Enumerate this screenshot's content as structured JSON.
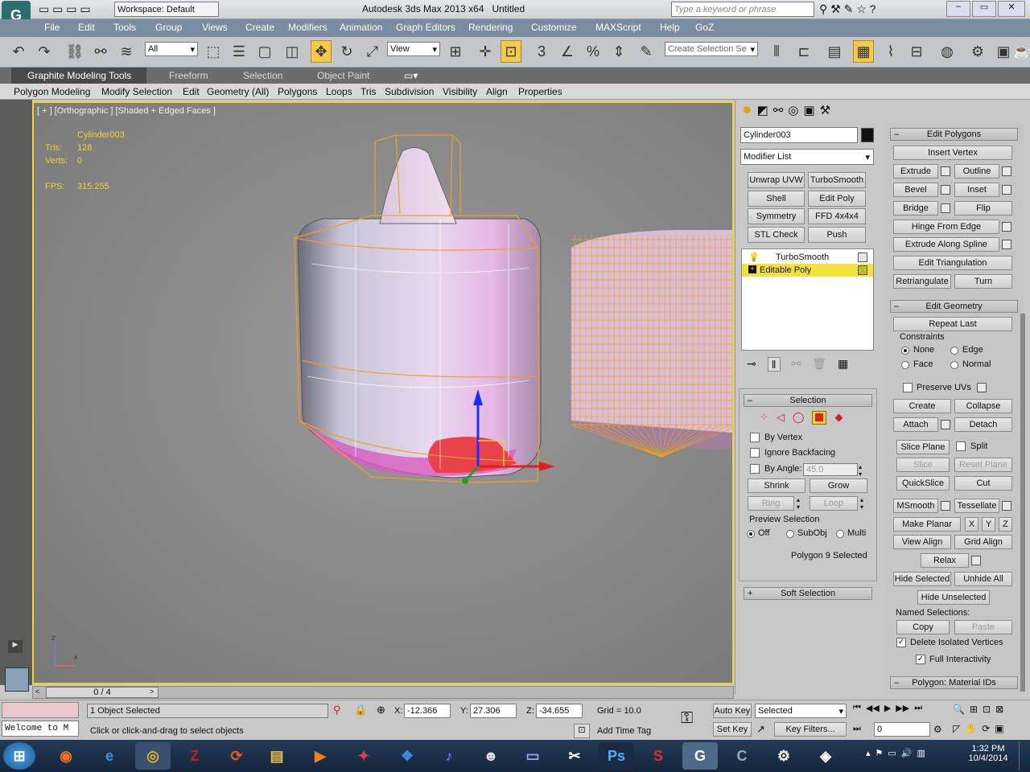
{
  "window": {
    "title": "Autodesk 3ds Max 2013 x64",
    "file": "Untitled",
    "workspace": "Workspace: Default",
    "search_placeholder": "Type a keyword or phrase"
  },
  "menu": [
    "File",
    "Edit",
    "Tools",
    "Group",
    "Views",
    "Create",
    "Modifiers",
    "Animation",
    "Graph Editors",
    "Rendering",
    "Customize",
    "MAXScript",
    "Help",
    "GoZ"
  ],
  "toolbar": {
    "filter": "All",
    "refcoord": "View",
    "selection_set": "Create Selection Se"
  },
  "ribbon_tabs": [
    "Graphite Modeling Tools",
    "Freeform",
    "Selection",
    "Object Paint"
  ],
  "ribbon_items": [
    "Polygon Modeling",
    "Modify Selection",
    "Edit",
    "Geometry (All)",
    "Polygons",
    "Loops",
    "Tris",
    "Subdivision",
    "Visibility",
    "Align",
    "Properties"
  ],
  "viewport": {
    "label": "[ + ] [Orthographic ] [Shaded + Edged Faces ]",
    "object": "Cylinder003",
    "tris_label": "Tris:",
    "tris": "128",
    "verts_label": "Verts:",
    "verts": "0",
    "fps_label": "FPS:",
    "fps": "315.255",
    "axis_z": "z",
    "axis_x": "x"
  },
  "command": {
    "name": "Cylinder003",
    "modifier_list": "Modifier List",
    "modbuttons": [
      "Unwrap UVW",
      "TurboSmooth",
      "Shell",
      "Edit Poly",
      "Symmetry",
      "FFD 4x4x4",
      "STL Check",
      "Push"
    ],
    "stack": [
      "TurboSmooth",
      "Editable Poly"
    ],
    "selection_header": "Selection",
    "by_vertex": "By Vertex",
    "ignore_backfacing": "Ignore Backfacing",
    "by_angle": "By Angle:",
    "angle_value": "45.0",
    "shrink": "Shrink",
    "grow": "Grow",
    "ring": "Ring",
    "loop": "Loop",
    "preview_selection": "Preview Selection",
    "preview_opts": [
      "Off",
      "SubObj",
      "Multi"
    ],
    "selected_info": "Polygon 9 Selected",
    "soft_selection": "Soft Selection"
  },
  "edit_polygons": {
    "header": "Edit Polygons",
    "insert_vertex": "Insert Vertex",
    "extrude": "Extrude",
    "outline": "Outline",
    "bevel": "Bevel",
    "inset": "Inset",
    "bridge": "Bridge",
    "flip": "Flip",
    "hinge": "Hinge From Edge",
    "extrude_spline": "Extrude Along Spline",
    "edit_tri": "Edit Triangulation",
    "retri": "Retriangulate",
    "turn": "Turn"
  },
  "edit_geometry": {
    "header": "Edit Geometry",
    "repeat_last": "Repeat Last",
    "constraints": "Constraints",
    "none": "None",
    "edge": "Edge",
    "face": "Face",
    "normal": "Normal",
    "preserve_uvs": "Preserve UVs",
    "create": "Create",
    "collapse": "Collapse",
    "attach": "Attach",
    "detach": "Detach",
    "slice_plane": "Slice Plane",
    "split": "Split",
    "slice": "Slice",
    "reset_plane": "Reset Plane",
    "quickslice": "QuickSlice",
    "cut": "Cut",
    "msmooth": "MSmooth",
    "tessellate": "Tessellate",
    "make_planar": "Make Planar",
    "x": "X",
    "y": "Y",
    "z": "Z",
    "view_align": "View Align",
    "grid_align": "Grid Align",
    "relax": "Relax",
    "hide_selected": "Hide Selected",
    "unhide_all": "Unhide All",
    "hide_unselected": "Hide Unselected",
    "named_selections": "Named Selections:",
    "copy": "Copy",
    "paste": "Paste",
    "delete_isolated": "Delete Isolated Vertices",
    "full_interactivity": "Full Interactivity",
    "material_ids": "Polygon: Material IDs"
  },
  "timeline": {
    "frame": "0 / 4"
  },
  "status": {
    "selected": "1 Object Selected",
    "prompt": "Click or click-and-drag to select objects",
    "x_label": "X:",
    "x": "-12.366",
    "y_label": "Y:",
    "y": "27.306",
    "z_label": "Z:",
    "z": "-34.655",
    "grid": "Grid = 10.0",
    "add_time_tag": "Add Time Tag",
    "auto_key": "Auto Key",
    "set_key": "Set Key",
    "key_mode": "Selected",
    "key_filters": "Key Filters...",
    "frame_field": "0",
    "welcome": "Welcome to M"
  },
  "taskbar": {
    "time": "1:32 PM",
    "date": "10/4/2014"
  },
  "colors": {
    "accent": "#f4d32b",
    "selected_poly": "#e8434a",
    "wire": "#f0a020"
  }
}
